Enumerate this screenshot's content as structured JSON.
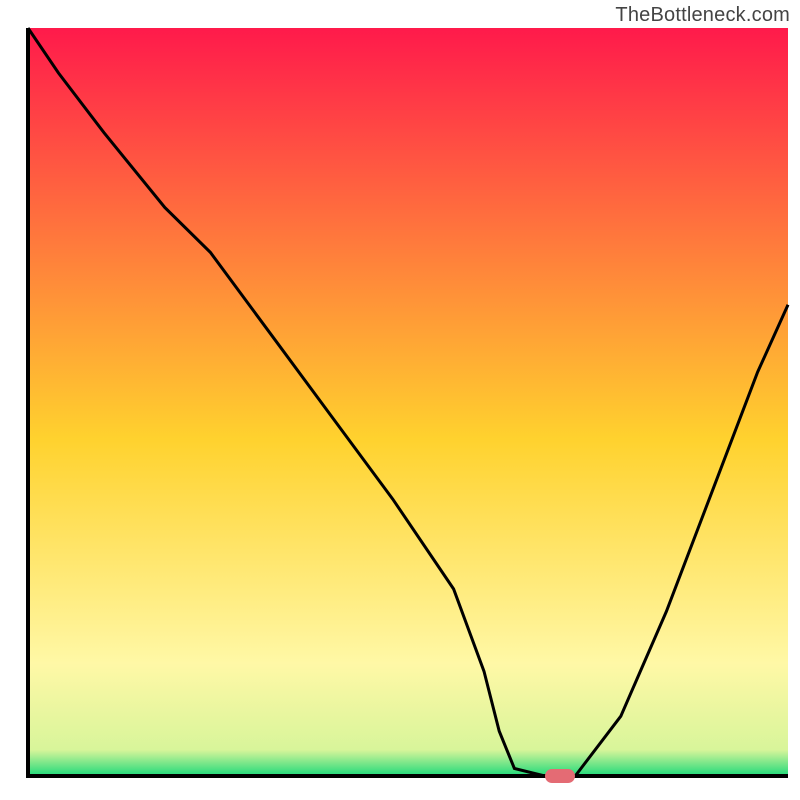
{
  "watermark": "TheBottleneck.com",
  "colors": {
    "grad_top": "#ff1a4b",
    "grad_mid": "#ffd22e",
    "grad_low": "#fff8a6",
    "grad_green": "#1ed97a",
    "axis": "#000000",
    "curve": "#000000",
    "marker": "#e46b74"
  },
  "chart_data": {
    "type": "line",
    "title": "",
    "xlabel": "",
    "ylabel": "",
    "xlim": [
      0,
      100
    ],
    "ylim": [
      0,
      100
    ],
    "x": [
      0,
      4,
      10,
      18,
      24,
      32,
      40,
      48,
      56,
      60,
      62,
      64,
      68,
      72,
      78,
      84,
      90,
      96,
      100
    ],
    "values": [
      100,
      94,
      86,
      76,
      70,
      59,
      48,
      37,
      25,
      14,
      6,
      1,
      0,
      0,
      8,
      22,
      38,
      54,
      63
    ],
    "marker": {
      "x": 70,
      "y": 0
    },
    "legend": [],
    "grid": false
  }
}
